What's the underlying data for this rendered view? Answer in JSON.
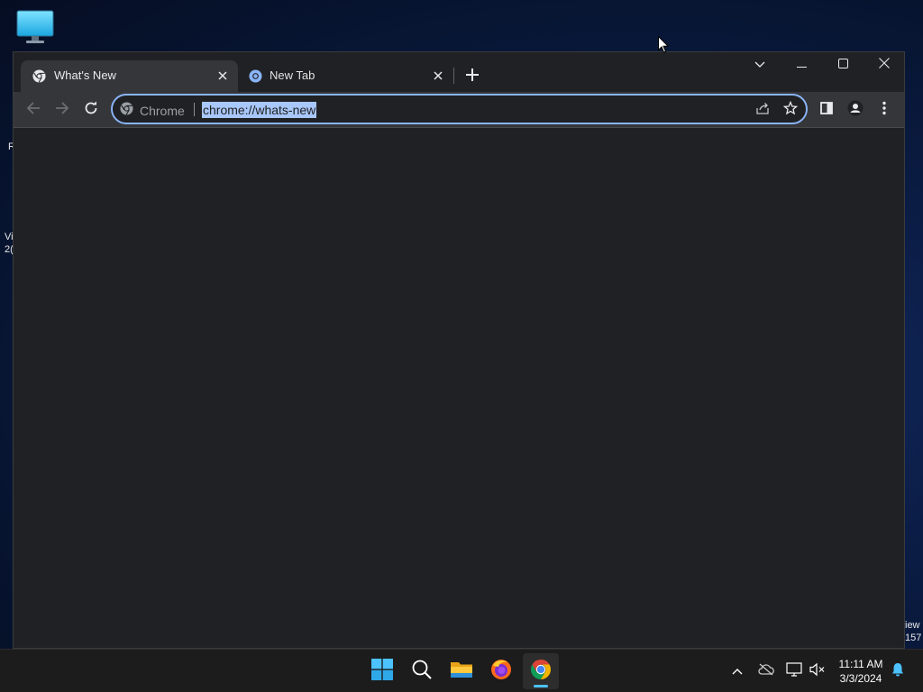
{
  "desktop": {
    "edge_left": [
      "R",
      "Vi",
      "2("
    ],
    "edge_right": [
      "iew",
      "157"
    ]
  },
  "browser": {
    "tabs": [
      {
        "title": "What's New",
        "active": true
      },
      {
        "title": "New Tab",
        "active": false
      }
    ],
    "omnibox": {
      "chip_label": "Chrome",
      "url": "chrome://whats-new"
    }
  },
  "taskbar": {
    "apps": [
      "windows-start",
      "search",
      "file-explorer",
      "firefox",
      "chrome"
    ],
    "clock": {
      "time": "11:11 AM",
      "date": "3/3/2024"
    }
  },
  "colors": {
    "accent": "#8ab4f8",
    "selection": "#a8c7fa",
    "window_bg": "#202124",
    "toolbar_bg": "#35363a",
    "taskbar_indicator": "#4cc2ff"
  }
}
